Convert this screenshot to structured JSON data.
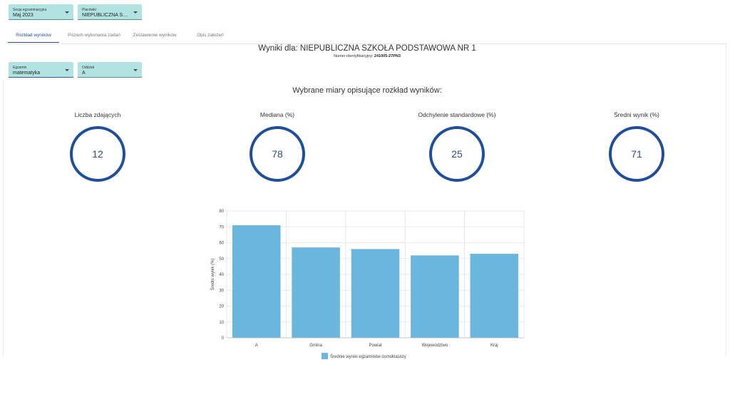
{
  "filters": {
    "session": {
      "label": "Sesja egzaminacyjna",
      "value": "Maj 2023"
    },
    "institution": {
      "label": "Placówki",
      "value": "NIEPUBLICZNA SZKOŁA..."
    },
    "exam": {
      "label": "Egzamin",
      "value": "matematyka"
    },
    "class": {
      "label": "Oddział",
      "value": "A"
    }
  },
  "tabs": [
    {
      "label": "Rozkład wyników",
      "active": true
    },
    {
      "label": "Poziom wykonania zadań",
      "active": false
    },
    {
      "label": "Zestawienie wyników",
      "active": false
    },
    {
      "label": "Opis założeń",
      "active": false
    }
  ],
  "header": {
    "title": "Wyniki dla: NIEPUBLICZNA SZKOŁA PODSTAWOWA NR 1",
    "id_label": "Numer identyfikacyjny:",
    "id_value": "241005-27PN3"
  },
  "measures": {
    "title": "Wybrane miary opisujące rozkład wyników:",
    "items": [
      {
        "label": "Liczba zdających",
        "value": "12"
      },
      {
        "label": "Mediana (%)",
        "value": "78"
      },
      {
        "label": "Odchylenie standardowe (%)",
        "value": "25"
      },
      {
        "label": "Średni wynik (%)",
        "value": "71"
      }
    ]
  },
  "colors": {
    "accent": "#1f4f99",
    "bar": "#6bb6dc",
    "select_bg": "#b2e3e3"
  },
  "chart_data": {
    "type": "bar",
    "categories": [
      "A",
      "Gmina",
      "Powiat",
      "Wojewodztwo",
      "Kraj"
    ],
    "series": [
      {
        "name": "Średnie wyniki egzaminów ósmoklasisty",
        "values": [
          71,
          57,
          56,
          52,
          53
        ]
      }
    ],
    "ylabel": "Średni wynik (%)",
    "xlabel": "",
    "ylim": [
      0,
      80
    ],
    "yticks": [
      0,
      10,
      20,
      30,
      40,
      50,
      60,
      70,
      80
    ],
    "grid": true,
    "legend": "bottom"
  }
}
